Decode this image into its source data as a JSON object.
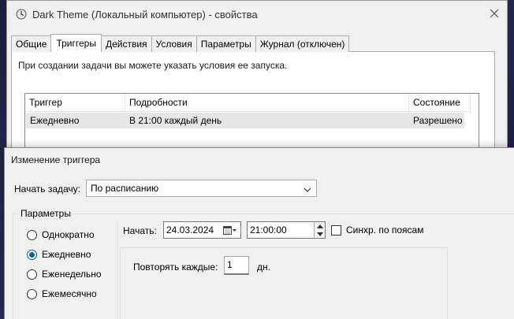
{
  "props_window": {
    "title": "Dark Theme (Локальный компьютер) - свойства",
    "tabs": [
      {
        "label": "Общие"
      },
      {
        "label": "Триггеры"
      },
      {
        "label": "Действия"
      },
      {
        "label": "Условия"
      },
      {
        "label": "Параметры"
      },
      {
        "label": "Журнал (отключен)"
      }
    ],
    "active_tab": "Триггеры",
    "hint": "При создании задачи вы можете указать условия ее запуска.",
    "table": {
      "headers": [
        "Триггер",
        "Подробности",
        "Состояние"
      ],
      "rows": [
        [
          "Ежедневно",
          "В 21:00 каждый день",
          "Разрешено"
        ]
      ]
    }
  },
  "edit_dialog": {
    "title": "Изменение триггера",
    "start_task_label": "Начать задачу:",
    "start_task_value": "По расписанию",
    "params_legend": "Параметры",
    "schedule_options": [
      {
        "label": "Однократно",
        "checked": false
      },
      {
        "label": "Ежедневно",
        "checked": true
      },
      {
        "label": "Еженедельно",
        "checked": false
      },
      {
        "label": "Ежемесячно",
        "checked": false
      }
    ],
    "begin_label": "Начать:",
    "begin_date": "24.03.2024",
    "begin_time": "21:00:00",
    "sync_timezones_label": "Синхр. по поясам",
    "sync_timezones_checked": false,
    "repeat_label": "Повторять каждые:",
    "repeat_value": "1",
    "repeat_unit": "дн."
  },
  "colors": {
    "accent": "#0060c0",
    "window_bg": "#f0f0f0",
    "selected_row": "#e6e6e6"
  }
}
